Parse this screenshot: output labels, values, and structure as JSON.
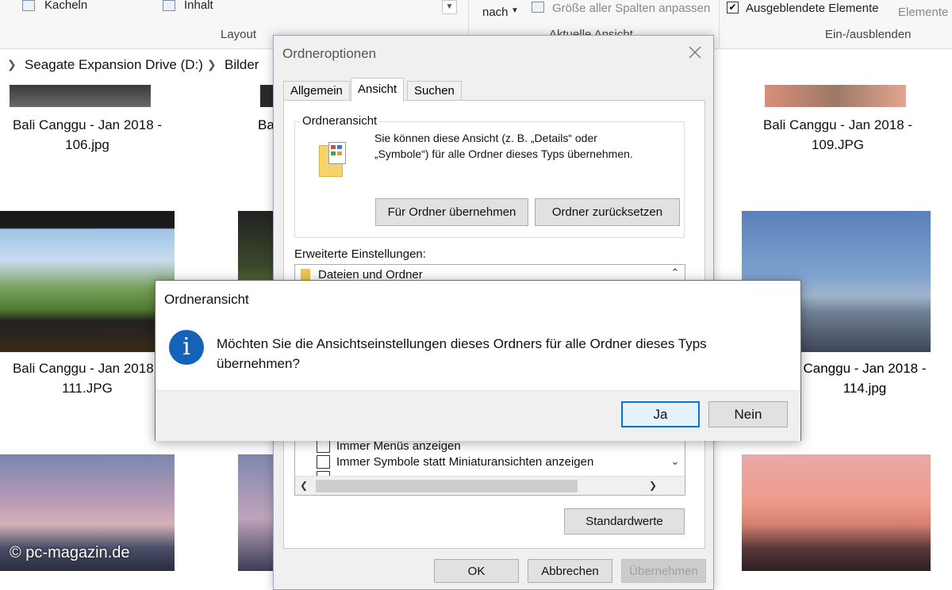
{
  "ribbon": {
    "kacheln": "Kacheln",
    "inhalt": "Inhalt",
    "layout_group": "Layout",
    "nach": "nach",
    "spalten": "Größe aller Spalten anpassen",
    "aktuelle_ansicht": "Aktuelle Ansicht",
    "ausgeblendete": "Ausgeblendete Elemente",
    "elemente": "Elemente a",
    "ein_aus": "Ein-/ausblenden"
  },
  "address": {
    "drive": "Seagate Expansion Drive (D:)",
    "folder": "Bilder"
  },
  "files": [
    {
      "line1": "Bali Canggu - Jan 2018 -",
      "line2": "106.jpg"
    },
    {
      "line1": "Ba",
      "line2": ""
    },
    {
      "line1": "Bali Canggu - Jan 2018 -",
      "line2": "109.JPG"
    },
    {
      "line1": "Bali Canggu - Jan 2018 -",
      "line2": "111.JPG"
    },
    {
      "line1": "Canggu - Jan 2018 -",
      "line2": "114.jpg"
    }
  ],
  "options_dialog": {
    "title": "Ordneroptionen",
    "tabs": [
      "Allgemein",
      "Ansicht",
      "Suchen"
    ],
    "group_title": "Ordneransicht",
    "desc_line1": "Sie können diese Ansicht (z. B. „Details“ oder",
    "desc_line2": "„Symbole“) für alle Ordner dieses Typs übernehmen.",
    "apply_button": "Für Ordner übernehmen",
    "reset_button": "Ordner zurücksetzen",
    "advanced_label": "Erweiterte Einstellungen:",
    "tree_item": "Dateien und Ordner",
    "settings": [
      "Immer Menüs anzeigen",
      "Immer Symbole statt Miniaturansichten anzeigen"
    ],
    "defaults_button": "Standardwerte",
    "ok_button": "OK",
    "cancel_button": "Abbrechen",
    "apply_bottom_button": "Übernehmen"
  },
  "confirm_dialog": {
    "title": "Ordneransicht",
    "message_line1": "Möchten Sie die Ansichtseinstellungen dieses Ordners für alle Ordner dieses Typs",
    "message_line2": "übernehmen?",
    "yes_button": "Ja",
    "no_button": "Nein"
  },
  "watermark": "© pc-magazin.de",
  "colors": {
    "accent": "#1883d7",
    "info_icon": "#1563b8"
  }
}
